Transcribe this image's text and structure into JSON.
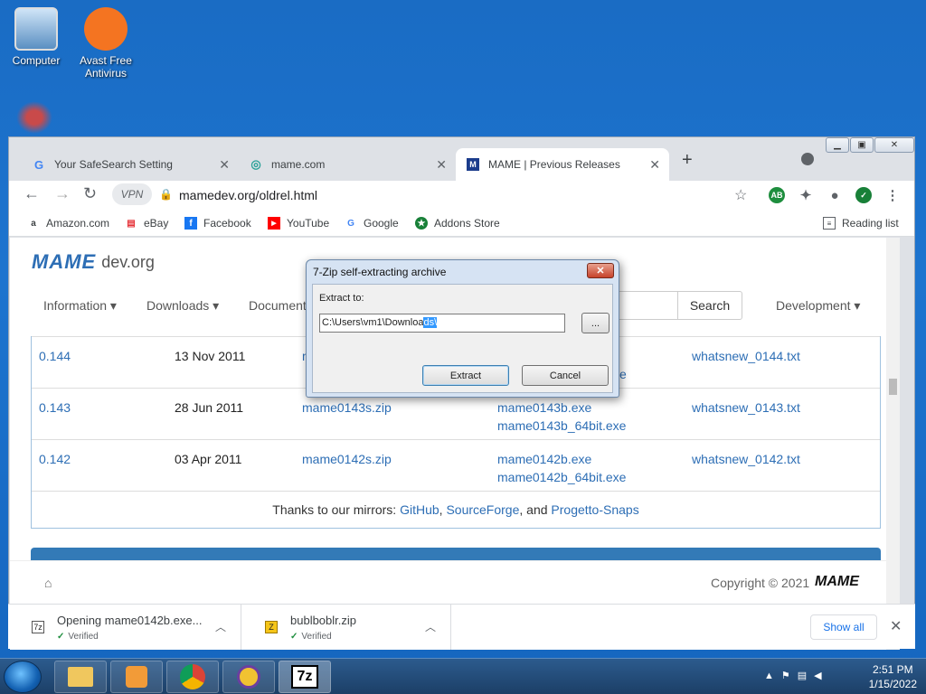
{
  "desktop": {
    "icons": [
      {
        "label_line1": "Computer",
        "label_line2": ""
      },
      {
        "label_line1": "Avast Free",
        "label_line2": "Antivirus"
      }
    ]
  },
  "browser": {
    "tabs": [
      {
        "title": "Your SafeSearch Setting"
      },
      {
        "title": "mame.com"
      },
      {
        "title": "MAME | Previous Releases"
      }
    ],
    "vpn_label": "VPN",
    "url": "mamedev.org/oldrel.html",
    "extension_badge": "AB",
    "bookmarks": [
      "Amazon.com",
      "eBay",
      "Facebook",
      "YouTube",
      "Google",
      "Addons Store"
    ],
    "reading_list": "Reading list"
  },
  "page": {
    "logo_brand": "MAME",
    "logo_suffix": "dev.org",
    "menu": [
      "Information ▾",
      "Downloads ▾",
      "Document"
    ],
    "menu_right": "Development ▾",
    "search_button": "Search",
    "releases": [
      {
        "version": "0.144",
        "date": "13 Nov 2011",
        "source": "m",
        "binary1": "",
        "binary2": "e",
        "whatsnew": "whatsnew_0144.txt"
      },
      {
        "version": "0.143",
        "date": "28 Jun 2011",
        "source": "mame0143s.zip",
        "binary1": "mame0143b.exe",
        "binary2": "mame0143b_64bit.exe",
        "whatsnew": "whatsnew_0143.txt"
      },
      {
        "version": "0.142",
        "date": "03 Apr 2011",
        "source": "mame0142s.zip",
        "binary1": "mame0142b.exe",
        "binary2": "mame0142b_64bit.exe",
        "whatsnew": "whatsnew_0142.txt"
      }
    ],
    "mirrors_prefix": "Thanks to our mirrors:",
    "mirror_github": "GitHub",
    "mirror_sourceforge": "SourceForge",
    "mirror_and": ", and",
    "mirror_progetto": "Progetto-Snaps",
    "copyright": "Copyright © 2021",
    "copyright_brand": "MAME"
  },
  "dialog": {
    "title": "7-Zip self-extracting archive",
    "close": "✕",
    "label": "Extract to:",
    "path_plain": "C:\\Users\\vm1\\Downloa",
    "path_selected": "ds\\",
    "browse": "...",
    "extract": "Extract",
    "cancel": "Cancel"
  },
  "downloads": [
    {
      "name": "Opening mame0142b.exe...",
      "status": "Verified"
    },
    {
      "name": "bublboblr.zip",
      "status": "Verified"
    }
  ],
  "show_all": "Show all",
  "taskbar": {
    "time": "2:51 PM",
    "date": "1/15/2022",
    "active_app": "7z"
  }
}
